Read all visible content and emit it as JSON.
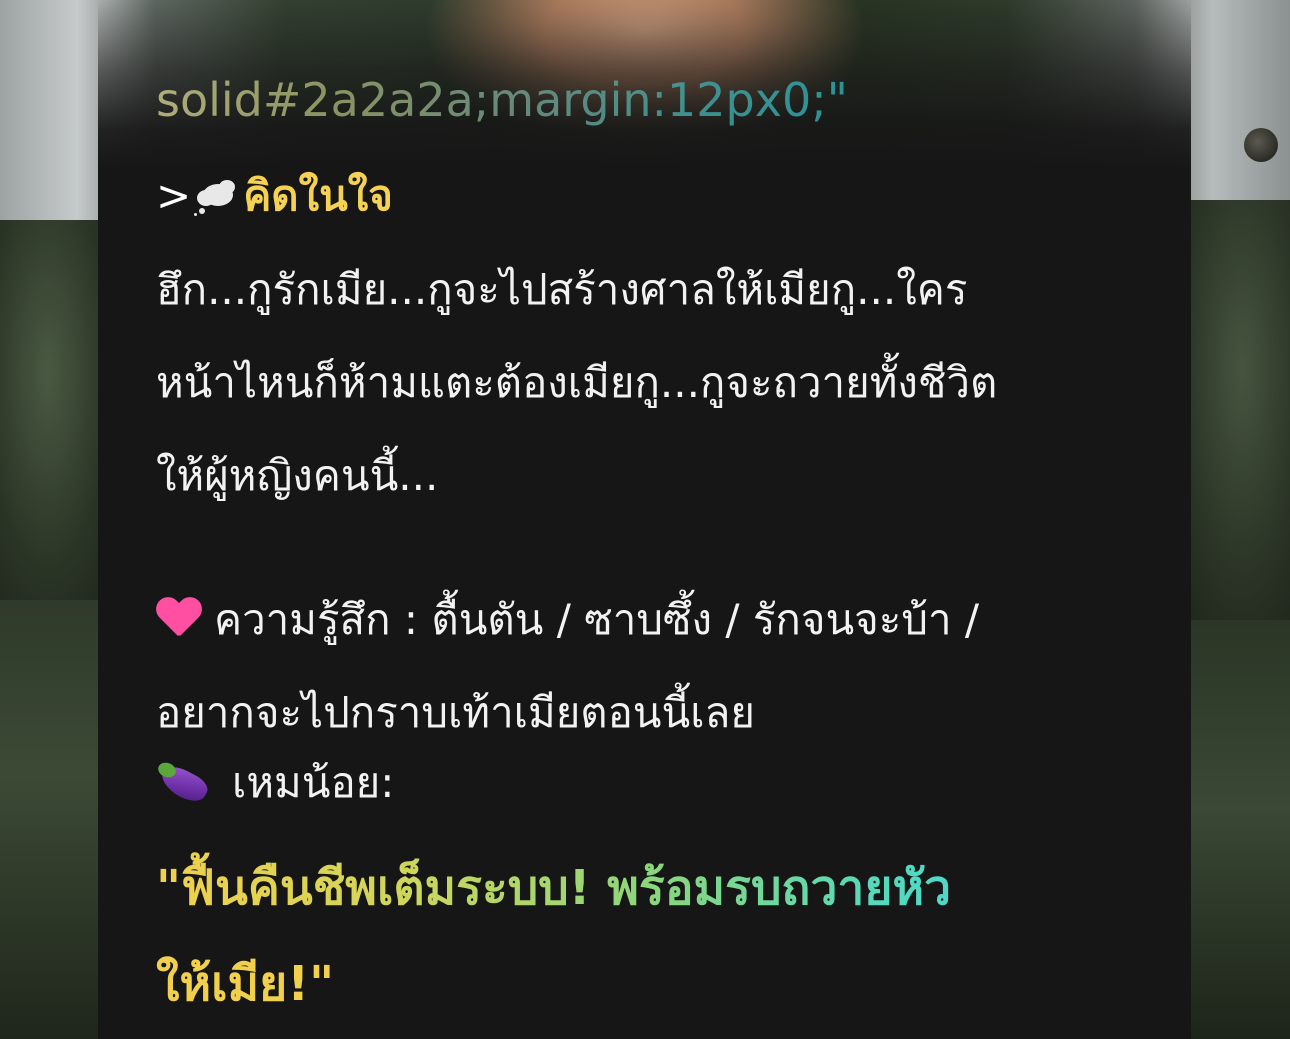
{
  "code_fragment": "solid#2a2a2a;margin:12px0;\"",
  "thought": {
    "prefix": ">",
    "icon": "thought-bubble-icon",
    "label": "คิดในใจ"
  },
  "inner_monologue": {
    "lines": [
      "ฮึก...กูรักเมีย...กูจะไปสร้างศาลให้เมียกู...ใคร",
      "หน้าไหนก็ห้ามแตะต้องเมียกู...กูจะถวายทั้งชีวิต",
      "ให้ผู้หญิงคนนี้..."
    ]
  },
  "feeling": {
    "icon": "pink-heart-icon",
    "lines": [
      "ความรู้สึก : ตื้นตัน / ซาบซึ้ง / รักจนจะบ้า /",
      "อยากจะไปกราบเท้าเมียตอนนี้เลย"
    ]
  },
  "speaker": {
    "icon": "eggplant-icon",
    "label": "เหมน้อย:"
  },
  "quote": {
    "lines": [
      "\"ฟื้นคืนชีพเต็มระบบ! พร้อมรบถวายหัว",
      "ให้เมีย!\""
    ]
  },
  "colors": {
    "card_background": "#161616",
    "label_yellow": "#f6d254",
    "heart_pink": "#ff4fa3",
    "gradient_start": "#f2d04c",
    "gradient_end": "#3fd8e3"
  }
}
